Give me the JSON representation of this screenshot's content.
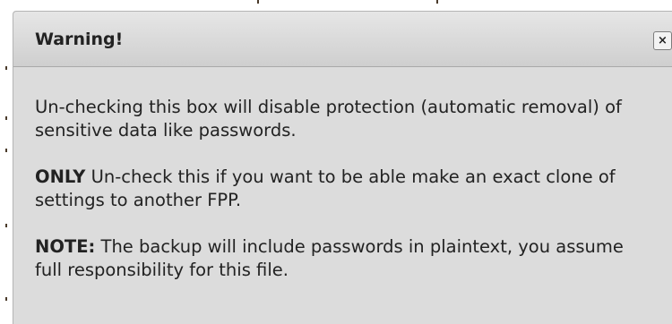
{
  "dialog": {
    "title": "Warning!",
    "close_label": "×",
    "paragraphs": [
      {
        "lead": "",
        "text": "Un-checking this box will disable protection (automatic removal) of sensitive data like passwords."
      },
      {
        "lead": "ONLY",
        "text": " Un-check this if you want to be able make an exact clone of settings to another FPP."
      },
      {
        "lead": "NOTE:",
        "text": " The backup will include passwords in plaintext, you assume full responsibility for this file."
      }
    ]
  },
  "icons": {
    "close": "close-icon"
  },
  "colors": {
    "dialog_background": "#dcdcdc",
    "titlebar_top": "#e6e6e6",
    "titlebar_bottom": "#cfcfcf",
    "text": "#222222",
    "border": "#b4b4b4"
  }
}
